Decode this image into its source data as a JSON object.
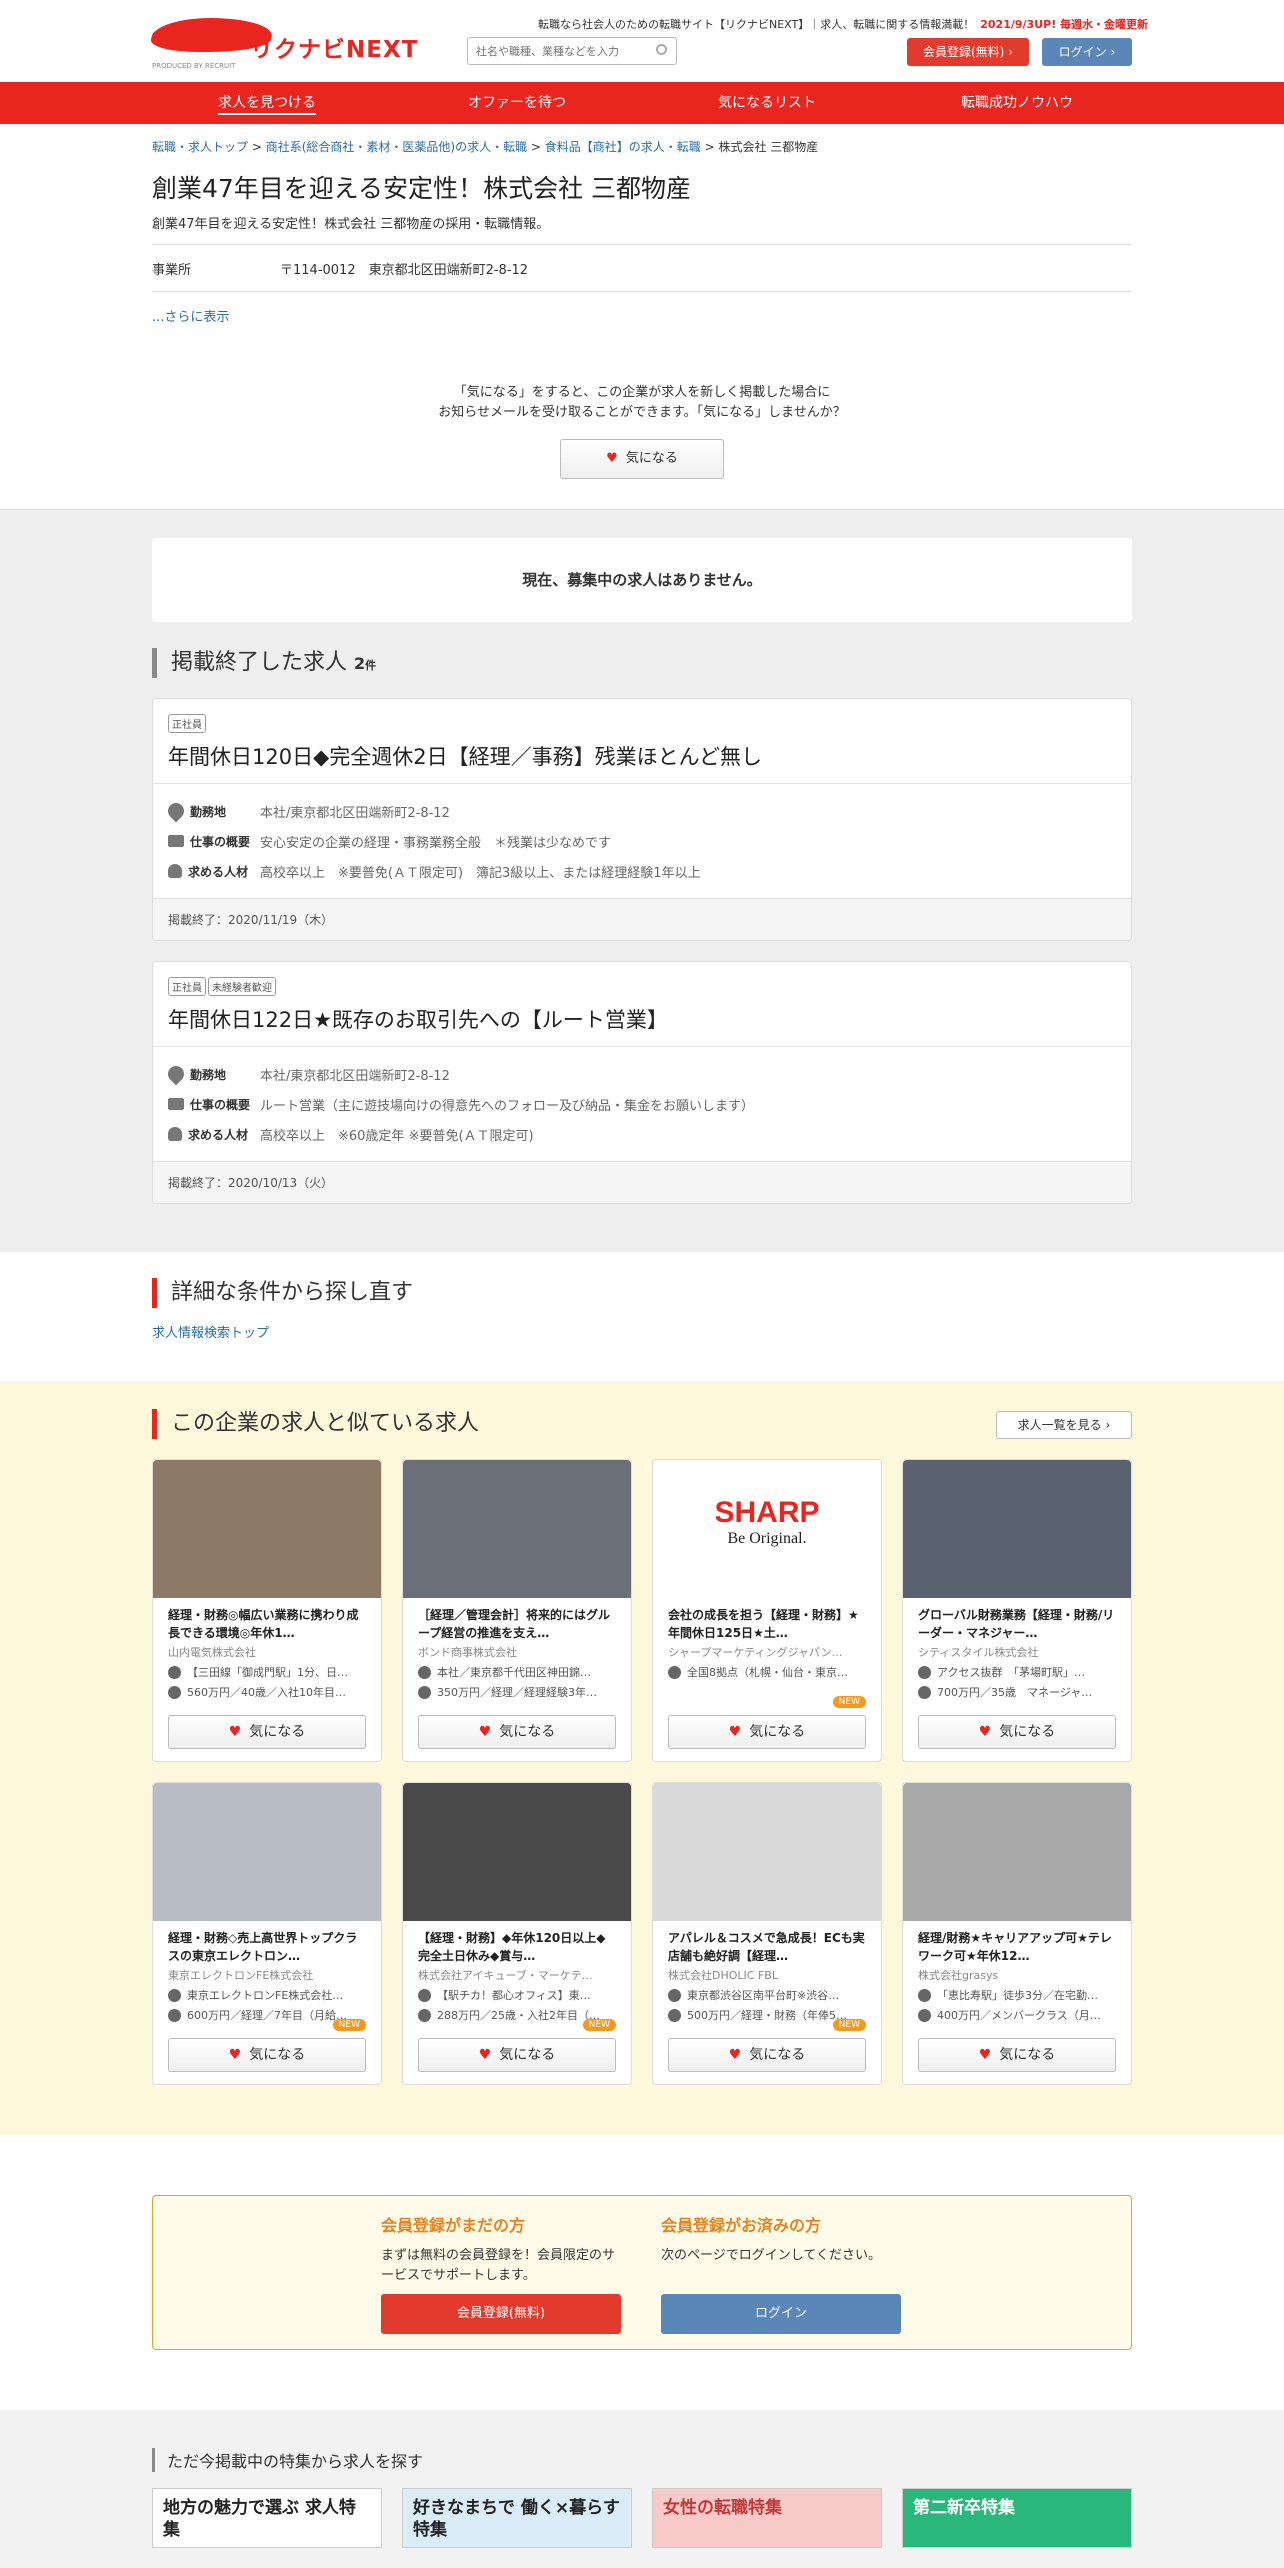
{
  "header": {
    "logo_text": "リクナビNEXT",
    "logo_produced": "PRODUCED BY RECRUIT",
    "tagline": "転職なら社会人のための転職サイト【リクナビNEXT】｜求人、転職に関する情報満載！",
    "update_note": "2021/9/3UP! 毎週水・金曜更新",
    "search_placeholder": "社名や職種、業種などを入力",
    "register_button": "会員登録(無料)",
    "login_button": "ログイン"
  },
  "nav": [
    "求人を見つける",
    "オファーを待つ",
    "気になるリスト",
    "転職成功ノウハウ"
  ],
  "breadcrumb": [
    "転職・求人トップ",
    "商社系(総合商社・素材・医薬品他)の求人・転職",
    "食料品【商社】の求人・転職",
    "株式会社 三都物産"
  ],
  "company": {
    "title": "創業47年目を迎える安定性！株式会社 三都物産",
    "subtitle": "創業47年目を迎える安定性！株式会社 三都物産の採用・転職情報。",
    "office_label": "事業所",
    "office_value": "〒114-0012　東京都北区田端新町2-8-12",
    "show_more": "...さらに表示"
  },
  "fav_prompt": {
    "line1": "「気になる」をすると、この企業が求人を新しく掲載した場合に",
    "line2": "お知らせメールを受け取ることができます。「気になる」しませんか？",
    "button": "気になる"
  },
  "no_jobs": "現在、募集中の求人はありません。",
  "ended": {
    "heading": "掲載終了した求人",
    "count": "2",
    "count_unit": "件",
    "jobs": [
      {
        "tags": [
          "正社員"
        ],
        "title": "年間休日120日◆完全週休2日【経理／事務】残業ほとんど無し",
        "location_label": "勤務地",
        "location": "本社/東京都北区田端新町2-8-12",
        "summary_label": "仕事の概要",
        "summary": "安心安定の企業の経理・事務業務全般　＊残業は少なめです",
        "req_label": "求める人材",
        "req": "高校卒以上　※要普免(ＡＴ限定可)　簿記3級以上、または経理経験1年以上",
        "end_date": "掲載終了：2020/11/19（木）"
      },
      {
        "tags": [
          "正社員",
          "未経験者歓迎"
        ],
        "title": "年間休日122日★既存のお取引先への【ルート営業】",
        "location_label": "勤務地",
        "location": "本社/東京都北区田端新町2-8-12",
        "summary_label": "仕事の概要",
        "summary": "ルート営業（主に遊技場向けの得意先へのフォロー及び納品・集金をお願いします）",
        "req_label": "求める人材",
        "req": "高校卒以上　※60歳定年 ※要普免(ＡＴ限定可)",
        "end_date": "掲載終了：2020/10/13（火）"
      }
    ]
  },
  "detail_search": {
    "heading": "詳細な条件から探し直す",
    "link": "求人情報検索トップ"
  },
  "similar": {
    "heading": "この企業の求人と似ている求人",
    "list_button": "求人一覧を見る",
    "fav_button": "気になる",
    "new_badge": "NEW",
    "jobs": [
      {
        "title": "経理・財務◎幅広い業務に携わり成長できる環境◎年休1…",
        "company": "山内電気株式会社",
        "loc": "【三田線「御成門駅」1分、日…",
        "salary": "560万円／40歳／入社10年目…",
        "new": false,
        "img": "#8c7a66"
      },
      {
        "title": "［経理／管理会計］将来的にはグループ経営の推進を支え…",
        "company": "ボンド商事株式会社",
        "loc": "本社／東京都千代田区神田錦…",
        "salary": "350万円／経理／経理経験3年…",
        "new": false,
        "img": "#6b6f78"
      },
      {
        "title": "会社の成長を担う【経理・財務】★年間休日125日★土…",
        "company": "シャープマーケティングジャパン…",
        "loc": "全国8拠点（札幌・仙台・東京…",
        "salary": "",
        "new": true,
        "img": "#ffffff"
      },
      {
        "title": "グローバル財務業務【経理・財務/リーダー・マネジャー…",
        "company": "シティスタイル株式会社",
        "loc": "アクセス抜群　「茅場町駅」…",
        "salary": "700万円／35歳　マネージャ…",
        "new": false,
        "img": "#5a6270"
      },
      {
        "title": "経理・財務◇売上高世界トップクラスの東京エレクトロン…",
        "company": "東京エレクトロンFE株式会社",
        "loc": "東京エレクトロンFE株式会社…",
        "salary": "600万円／経理／7年目（月給…",
        "new": true,
        "img": "#b8bcc6"
      },
      {
        "title": "【経理・財務】◆年休120日以上◆完全土日休み◆賞与…",
        "company": "株式会社アイキューブ・マーケテ…",
        "loc": "【駅チカ！都心オフィス】東…",
        "salary": "288万円／25歳・入社2年目（…",
        "new": true,
        "img": "#4a4a4a"
      },
      {
        "title": "アパレル＆コスメで急成長！ECも実店舗も絶好調【経理…",
        "company": "株式会社DHOLIC FBL",
        "loc": "東京都渋谷区南平台町※渋谷…",
        "salary": "500万円／経理・財務（年俸5…",
        "new": true,
        "img": "#d9d9d9"
      },
      {
        "title": "経理/財務★キャリアアップ可★テレワーク可★年休12…",
        "company": "株式会社grasys",
        "loc": "「恵比寿駅」徒歩3分／在宅勤…",
        "salary": "400万円／メンバークラス（月…",
        "new": false,
        "img": "#a8a8a8"
      }
    ]
  },
  "member": {
    "new_heading": "会員登録がまだの方",
    "new_text": "まずは無料の会員登録を！会員限定のサービスでサポートします。",
    "new_button": "会員登録(無料)",
    "exist_heading": "会員登録がお済みの方",
    "exist_text": "次のページでログインしてください。",
    "exist_button": "ログイン"
  },
  "features": {
    "heading": "ただ今掲載中の特集から求人を探す",
    "banners": [
      "地方の魅力で選ぶ 求人特集",
      "好きなまちで 働く×暮らす特集",
      "女性の転職特集",
      "第二新卒特集"
    ]
  },
  "colors": {
    "brand_red": "#e8251f",
    "login_blue": "#5b86b8",
    "accent_orange": "#e8831f"
  }
}
